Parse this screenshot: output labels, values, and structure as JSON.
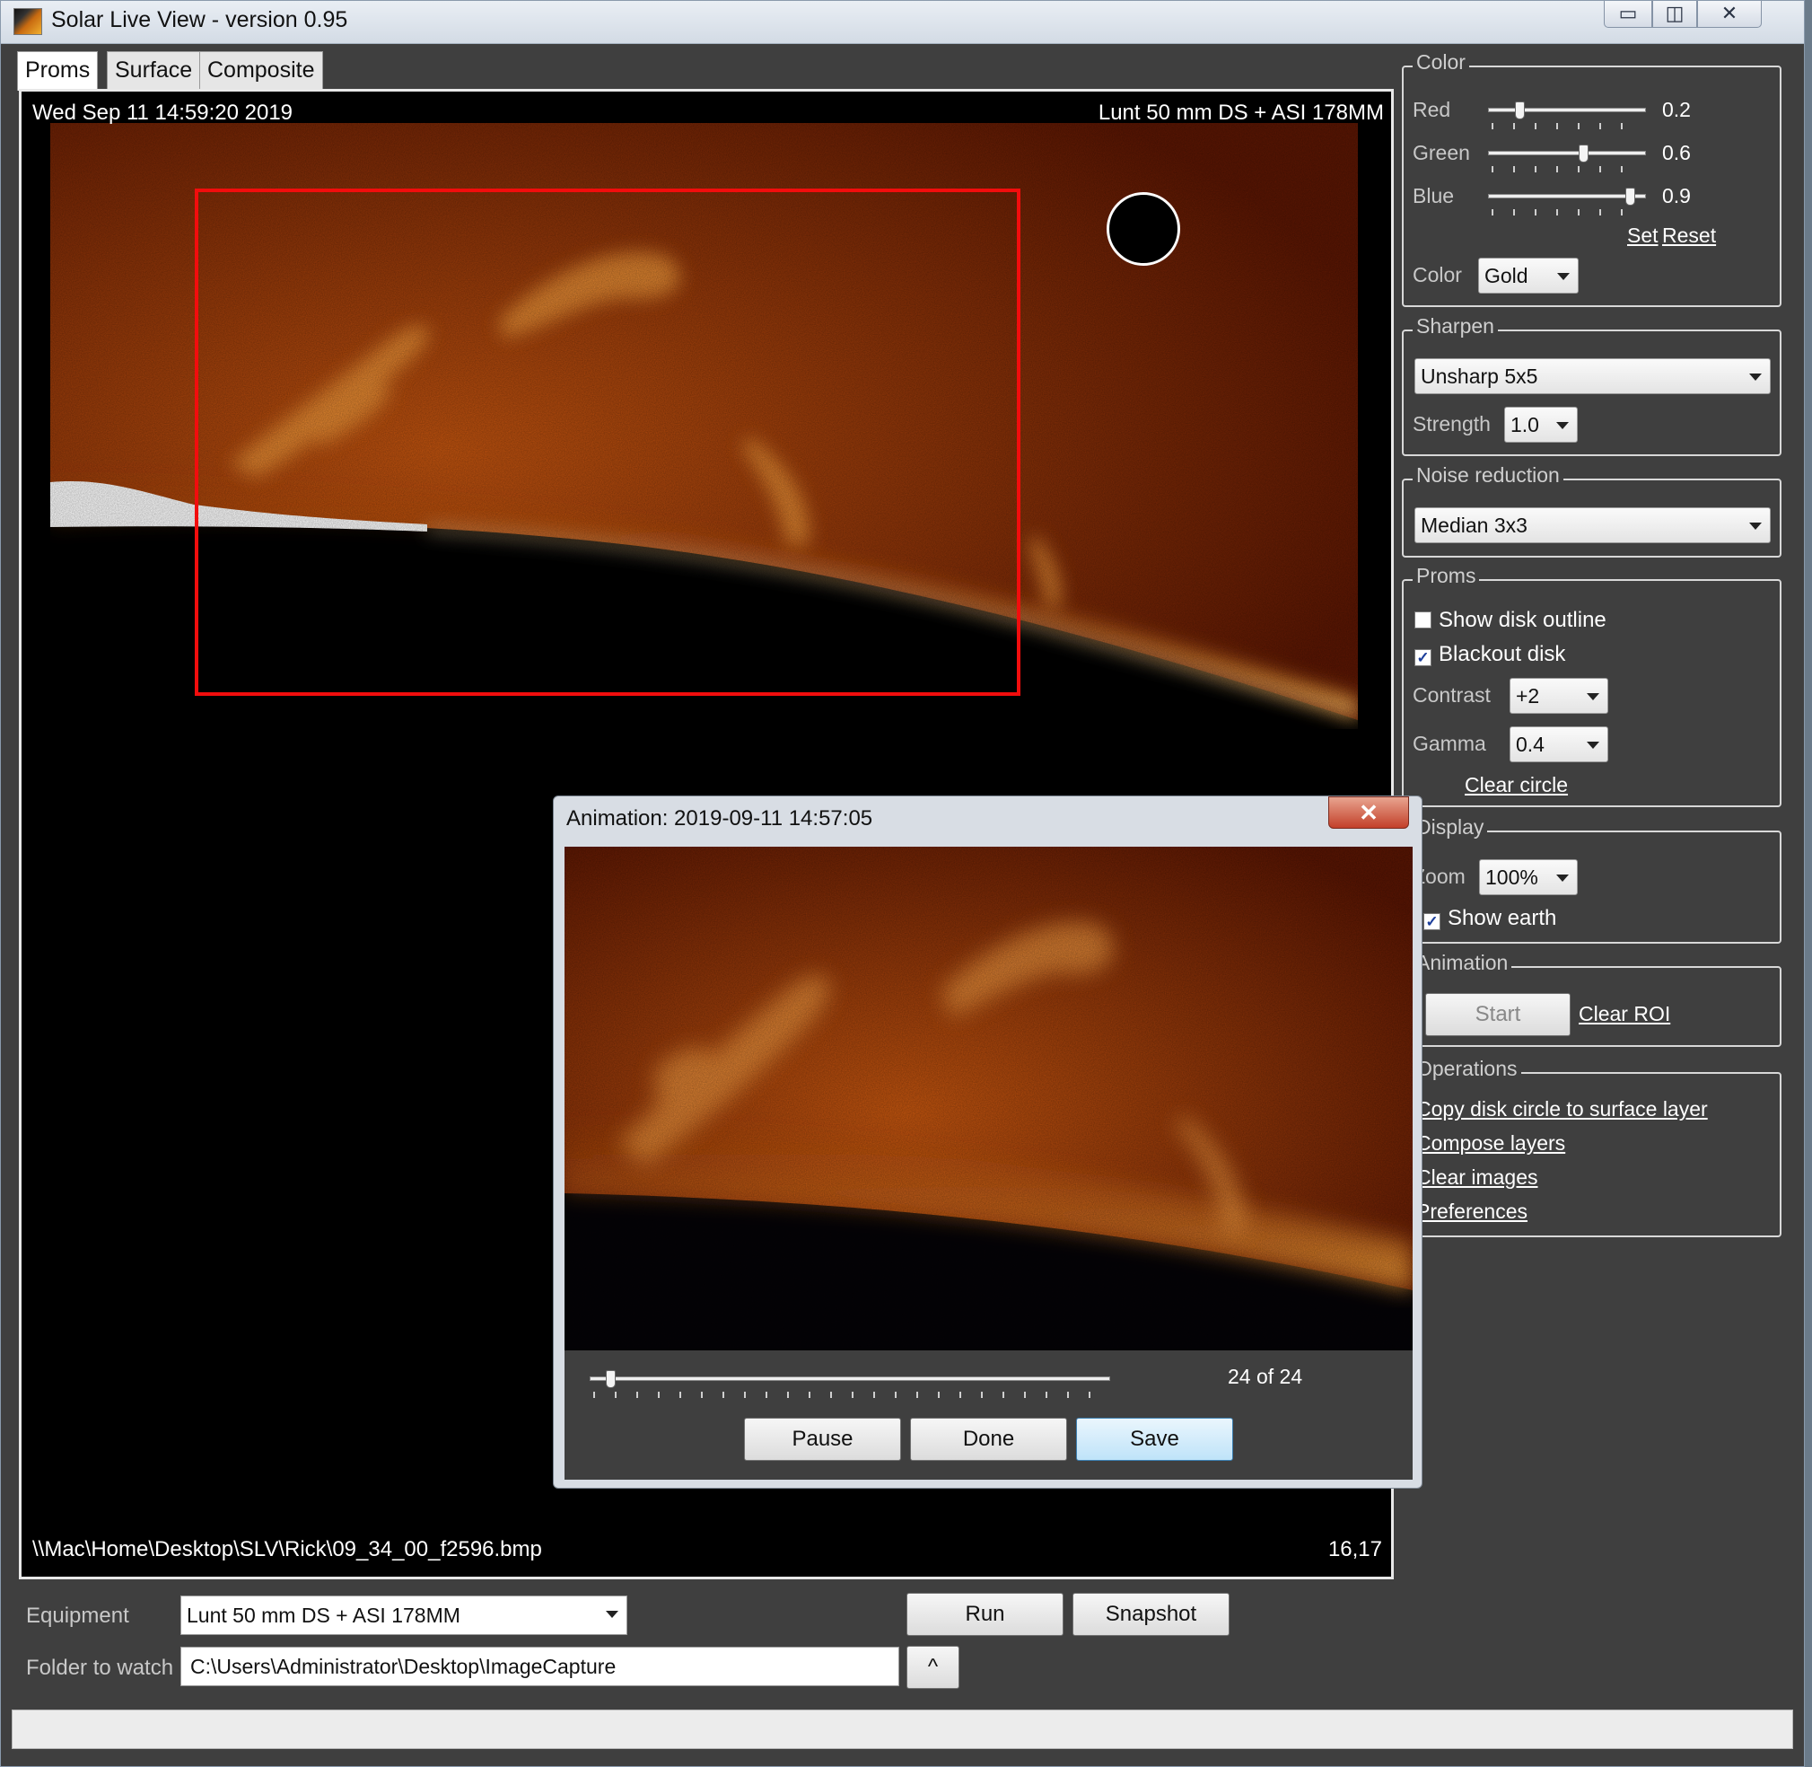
{
  "window": {
    "title": "Solar Live View - version 0.95",
    "minimize_label": "▭",
    "maximize_label": "◫",
    "close_label": "✕"
  },
  "tabs": [
    {
      "label": "Proms",
      "active": true
    },
    {
      "label": "Surface",
      "active": false
    },
    {
      "label": "Composite",
      "active": false
    }
  ],
  "image_view": {
    "timestamp": "Wed Sep 11 14:59:20 2019",
    "equipment": "Lunt 50 mm DS + ASI 178MM",
    "file_path": "\\\\Mac\\Home\\Desktop\\SLV\\Rick\\09_34_00_f2596.bmp",
    "coordinates": "16,17"
  },
  "color": {
    "title": "Color",
    "red_label": "Red",
    "red_value": "0.2",
    "red_level": 0.2,
    "green_label": "Green",
    "green_value": "0.6",
    "green_level": 0.6,
    "blue_label": "Blue",
    "blue_value": "0.9",
    "blue_level": 0.9,
    "set_link": "Set",
    "reset_link": "Reset",
    "preset_label": "Color",
    "preset_value": "Gold"
  },
  "sharpen": {
    "title": "Sharpen",
    "method": "Unsharp 5x5",
    "strength_label": "Strength",
    "strength_value": "1.0"
  },
  "noise": {
    "title": "Noise reduction",
    "method": "Median 3x3"
  },
  "proms": {
    "title": "Proms",
    "show_disk_outline": "Show disk outline",
    "show_disk_outline_checked": false,
    "blackout_disk": "Blackout disk",
    "blackout_disk_checked": true,
    "contrast_label": "Contrast",
    "contrast_value": "+2",
    "gamma_label": "Gamma",
    "gamma_value": "0.4",
    "clear_circle": "Clear circle"
  },
  "display": {
    "title": "Display",
    "zoom_label": "Zoom",
    "zoom_value": "100%",
    "show_earth": "Show earth",
    "show_earth_checked": true
  },
  "animation": {
    "title": "Animation",
    "start_button": "Start",
    "clear_roi": "Clear ROI"
  },
  "operations": {
    "title": "Operations",
    "items": [
      "Copy disk circle to surface layer",
      "Compose layers",
      "Clear images",
      "Preferences"
    ]
  },
  "bottom": {
    "equipment_label": "Equipment",
    "equipment_value": "Lunt 50 mm DS + ASI 178MM",
    "run_button": "Run",
    "snapshot_button": "Snapshot",
    "folder_label": "Folder to watch",
    "folder_value": "C:\\Users\\Administrator\\Desktop\\ImageCapture",
    "folder_browse": "^"
  },
  "animation_dialog": {
    "title": "Animation: 2019-09-11 14:57:05",
    "close_label": "✕",
    "counter": "24 of 24",
    "frame_position": 0.04,
    "pause_button": "Pause",
    "done_button": "Done",
    "save_button": "Save"
  },
  "colors": {
    "roi": "#f20d0d",
    "solar_bright": "#f7a43a",
    "solar_dark": "#5c1602",
    "panel_bg": "#3f3f3f"
  }
}
